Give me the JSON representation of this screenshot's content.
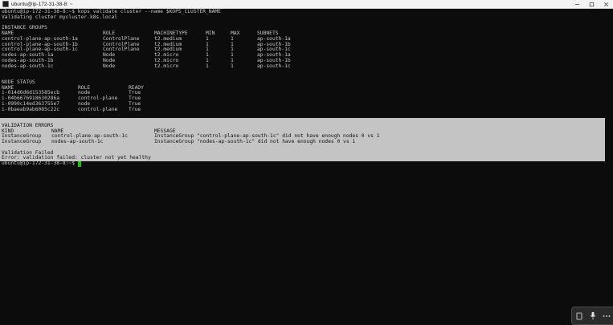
{
  "window": {
    "title": "ubuntu@ip-172-31-38-8: ~",
    "icon": "terminal-icon",
    "controls": [
      "minimize-icon",
      "maximize-icon",
      "close-icon"
    ]
  },
  "terminal": {
    "command_line": "ubuntu@ip-172-31-38-8:~$ kops validate cluster --name $KOPS_CLUSTER_NAME",
    "validating_line": "Validating cluster mycluster.k8s.local",
    "instance_groups": {
      "title": "INSTANCE GROUPS",
      "headers": [
        "NAME",
        "ROLE",
        "MACHINETYPE",
        "MIN",
        "MAX",
        "SUBNETS"
      ],
      "rows": [
        [
          "control-plane-ap-south-1a",
          "ControlPlane",
          "t2.medium",
          "1",
          "1",
          "ap-south-1a"
        ],
        [
          "control-plane-ap-south-1b",
          "ControlPlane",
          "t2.medium",
          "1",
          "1",
          "ap-south-1b"
        ],
        [
          "control-plane-ap-south-1c",
          "ControlPlane",
          "t2.medium",
          "1",
          "1",
          "ap-south-1c"
        ],
        [
          "nodes-ap-south-1a",
          "Node",
          "t2.micro",
          "1",
          "1",
          "ap-south-1a"
        ],
        [
          "nodes-ap-south-1b",
          "Node",
          "t2.micro",
          "1",
          "1",
          "ap-south-1b"
        ],
        [
          "nodes-ap-south-1c",
          "Node",
          "t2.micro",
          "1",
          "1",
          "ap-south-1c"
        ]
      ]
    },
    "node_status": {
      "title": "NODE STATUS",
      "headers": [
        "NAME",
        "ROLE",
        "READY"
      ],
      "rows": [
        [
          "i-014d6d6d153585ecb",
          "node",
          "True"
        ],
        [
          "i-04b6676918630286a",
          "control-plane",
          "True"
        ],
        [
          "i-0990c14ed363755e7",
          "node",
          "True"
        ],
        [
          "i-0baeab9ab6085c22c",
          "control-plane",
          "True"
        ]
      ]
    },
    "validation_errors": {
      "title": "VALIDATION ERRORS",
      "headers": [
        "KIND",
        "NAME",
        "MESSAGE"
      ],
      "rows": [
        [
          "InstanceGroup",
          "control-plane-ap-south-1c",
          "InstanceGroup \"control-plane-ap-south-1c\" did not have enough nodes 0 vs 1"
        ],
        [
          "InstanceGroup",
          "nodes-ap-south-1c",
          "InstanceGroup \"nodes-ap-south-1c\" did not have enough nodes 0 vs 1"
        ]
      ],
      "failed": "Validation Failed",
      "error": "Error: validation failed: cluster not yet healthy"
    },
    "prompt": "ubuntu@ip-172-31-38-8:~$ "
  },
  "floating_toolbar": {
    "icons": [
      "tablet-icon",
      "microphone-icon",
      "more-icon"
    ],
    "colors": {
      "background": "#2b2b2b"
    }
  },
  "colors": {
    "background": "#0c0c0c",
    "text": "#c8c8c8",
    "selection": "#c4c4c4",
    "cursor": "#16c60c"
  }
}
